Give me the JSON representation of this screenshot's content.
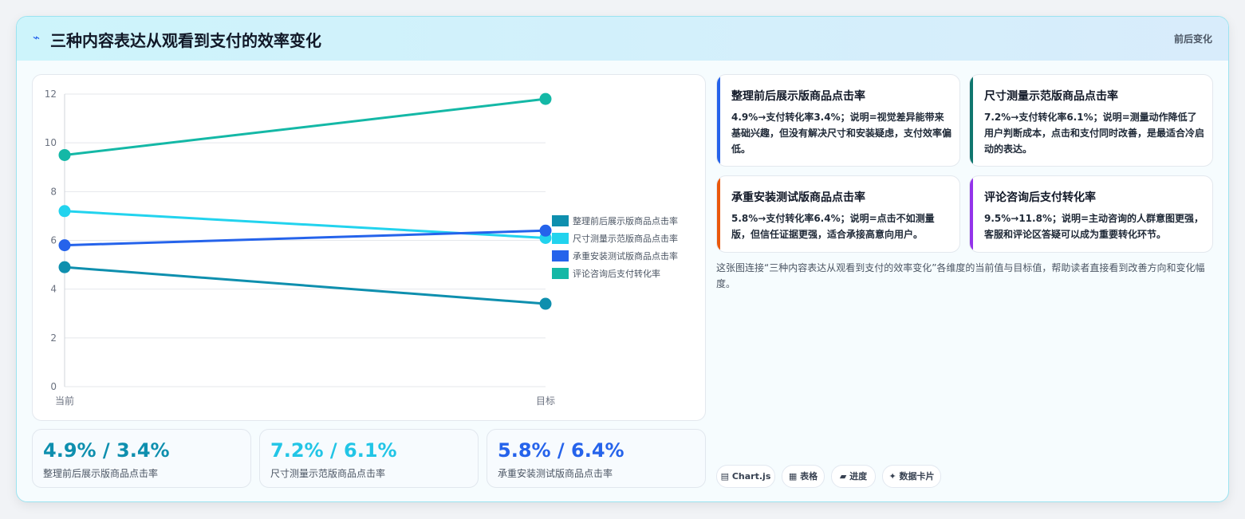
{
  "header": {
    "icon": "lightning-icon",
    "title": "三种内容表达从观看到支付的效率变化",
    "tag": "前后变化"
  },
  "chart_data": {
    "type": "line",
    "categories": [
      "当前",
      "目标"
    ],
    "ylim": [
      0,
      12
    ],
    "yticks": [
      0,
      2,
      4,
      6,
      8,
      10,
      12
    ],
    "grid": true,
    "legend_position": "right",
    "series": [
      {
        "name": "整理前后展示版商品点击率",
        "values": [
          4.9,
          3.4
        ],
        "color": "#0e8fae"
      },
      {
        "name": "尺寸测量示范版商品点击率",
        "values": [
          7.2,
          6.1
        ],
        "color": "#22d3ee"
      },
      {
        "name": "承重安装测试版商品点击率",
        "values": [
          5.8,
          6.4
        ],
        "color": "#2563eb"
      },
      {
        "name": "评论咨询后支付转化率",
        "values": [
          9.5,
          11.8
        ],
        "color": "#14b8a6"
      }
    ]
  },
  "stats": [
    {
      "value": "4.9% / 3.4%",
      "label": "整理前后展示版商品点击率",
      "color": "#0e8fae"
    },
    {
      "value": "7.2% / 6.1%",
      "label": "尺寸测量示范版商品点击率",
      "color": "#22c5e6"
    },
    {
      "value": "5.8% / 6.4%",
      "label": "承重安装测试版商品点击率",
      "color": "#2563eb"
    }
  ],
  "notes": [
    {
      "title": "整理前后展示版商品点击率",
      "body": "4.9%→支付转化率3.4%；说明=视觉差异能带来基础兴趣，但没有解决尺寸和安装疑虑，支付效率偏低。",
      "accent": "#2563eb"
    },
    {
      "title": "尺寸测量示范版商品点击率",
      "body": "7.2%→支付转化率6.1%；说明=测量动作降低了用户判断成本，点击和支付同时改善，是最适合冷启动的表达。",
      "accent": "#0f766e"
    },
    {
      "title": "承重安装测试版商品点击率",
      "body": "5.8%→支付转化率6.4%；说明=点击不如测量版，但信任证据更强，适合承接高意向用户。",
      "accent": "#ea580c"
    },
    {
      "title": "评论咨询后支付转化率",
      "body": "9.5%→11.8%；说明=主动咨询的人群意图更强，客服和评论区答疑可以成为重要转化环节。",
      "accent": "#9333ea"
    }
  ],
  "description": "这张图连接“三种内容表达从观看到支付的效率变化”各维度的当前值与目标值，帮助读者直接看到改善方向和变化幅度。",
  "chips": [
    {
      "icon": "▤",
      "label": "Chart.js"
    },
    {
      "icon": "▦",
      "label": "表格"
    },
    {
      "icon": "▰",
      "label": "进度"
    },
    {
      "icon": "✦",
      "label": "数据卡片"
    }
  ]
}
